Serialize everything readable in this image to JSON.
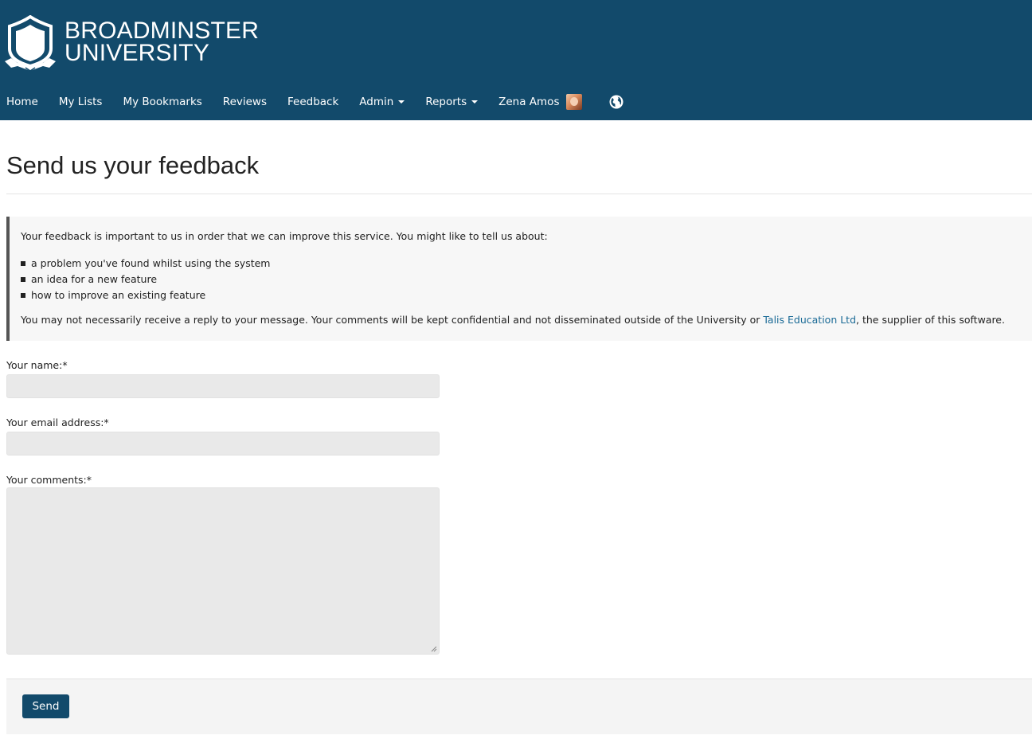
{
  "brand": {
    "line1": "BROADMINSTER",
    "line2": "UNIVERSITY",
    "header_color": "#124a6b"
  },
  "nav": {
    "items": [
      {
        "label": "Home"
      },
      {
        "label": "My Lists"
      },
      {
        "label": "My Bookmarks"
      },
      {
        "label": "Reviews"
      },
      {
        "label": "Feedback"
      },
      {
        "label": "Admin",
        "dropdown": true
      },
      {
        "label": "Reports",
        "dropdown": true
      }
    ],
    "user_name": "Zena Amos",
    "language_icon": "globe-icon"
  },
  "page": {
    "title": "Send us your feedback"
  },
  "info": {
    "intro": "Your feedback is important to us in order that we can improve this service. You might like to tell us about:",
    "bullets": [
      "a problem you've found whilst using the system",
      "an idea for a new feature",
      "how to improve an existing feature"
    ],
    "note_before": "You may not necessarily receive a reply to your message. Your comments will be kept confidential and not disseminated outside of the University or ",
    "link_text": "Talis Education Ltd",
    "note_after": ", the supplier of this software.",
    "link_color": "#1a6a96"
  },
  "form": {
    "name_label": "Your name:*",
    "name_value": "",
    "email_label": "Your email address:*",
    "email_value": "",
    "comments_label": "Your comments:*",
    "comments_value": "",
    "send_label": "Send"
  }
}
